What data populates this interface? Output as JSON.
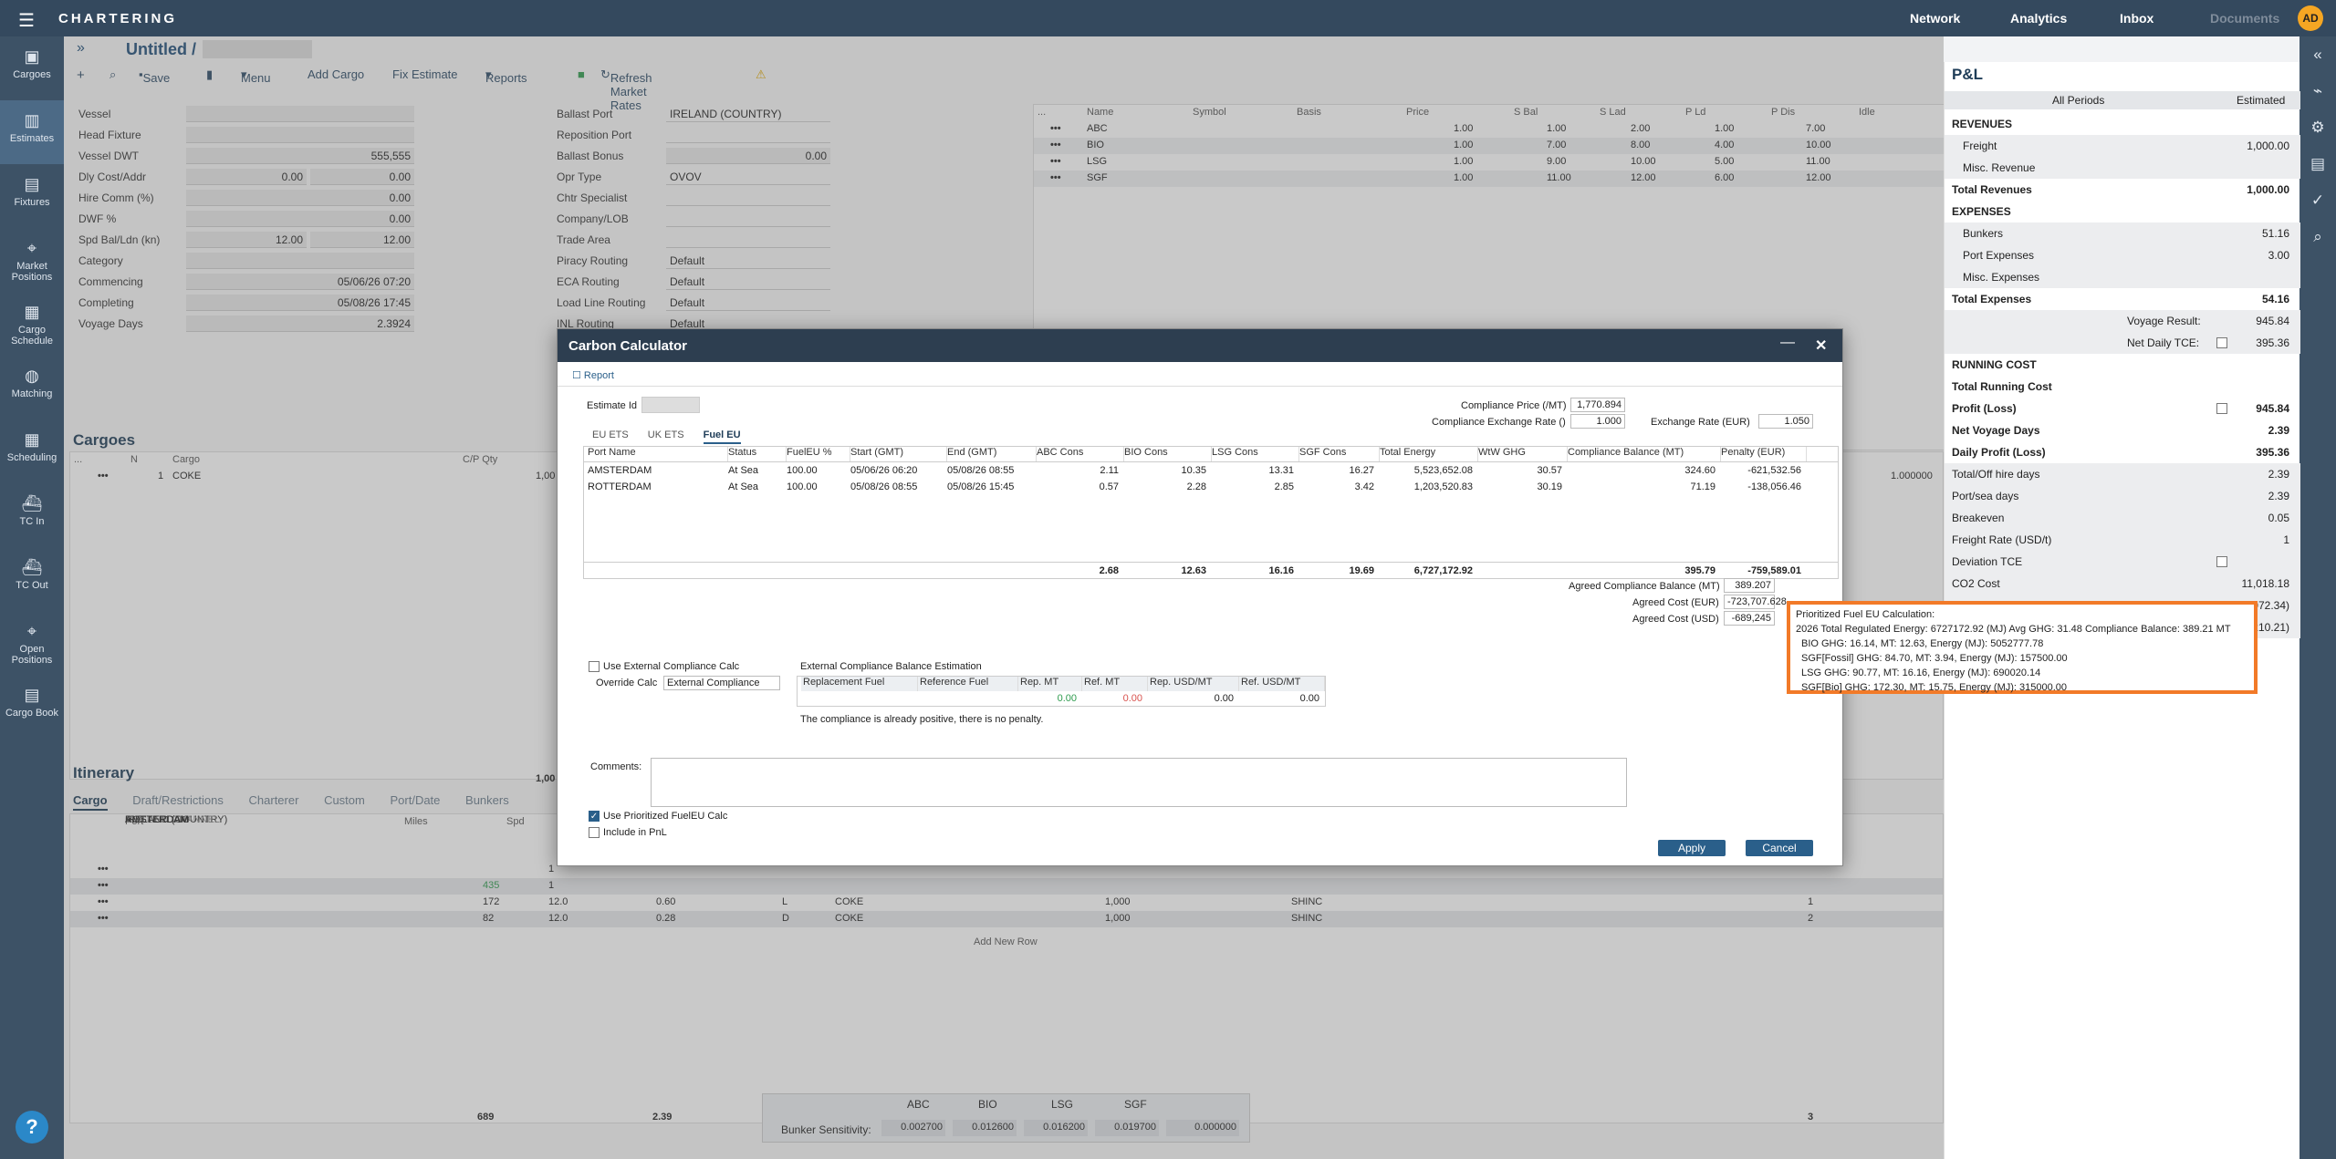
{
  "app": {
    "brand": "CHARTERING",
    "nav": [
      "Network",
      "Analytics",
      "Inbox",
      "Documents"
    ],
    "avatar": "AD"
  },
  "leftnav": [
    {
      "label": "Cargoes",
      "icon": "box-icon"
    },
    {
      "label": "Estimates",
      "icon": "columns-icon"
    },
    {
      "label": "Fixtures",
      "icon": "book-icon"
    },
    {
      "label": "Market Positions",
      "icon": "pin-icon"
    },
    {
      "label": "Cargo Schedule",
      "icon": "schedule-icon"
    },
    {
      "label": "Matching",
      "icon": "globe-icon"
    },
    {
      "label": "Scheduling",
      "icon": "calendar-icon"
    },
    {
      "label": "TC In",
      "icon": "ship-icon"
    },
    {
      "label": "TC Out",
      "icon": "ship-icon"
    },
    {
      "label": "Open Positions",
      "icon": "pin-icon"
    },
    {
      "label": "Cargo Book",
      "icon": "book-icon"
    }
  ],
  "header": {
    "title": "Untitled /",
    "toolbar": [
      "Save",
      "Menu",
      "Add Cargo",
      "Fix Estimate",
      "Reports",
      "Refresh Market Rates"
    ]
  },
  "form_left": [
    {
      "label": "Vessel",
      "v1": "",
      "v2": ""
    },
    {
      "label": "Head Fixture",
      "v1": "",
      "v2": ""
    },
    {
      "label": "Vessel DWT",
      "v1": "555,555",
      "v2": ""
    },
    {
      "label": "Dly Cost/Addr",
      "v1": "0.00",
      "v2": "0.00"
    },
    {
      "label": "Hire Comm (%)",
      "v1": "0.00",
      "v2": ""
    },
    {
      "label": "DWF %",
      "v1": "0.00",
      "v2": ""
    },
    {
      "label": "Spd Bal/Ldn (kn)",
      "v1": "12.00",
      "v2": "12.00"
    },
    {
      "label": "Category",
      "v1": "",
      "v2": ""
    },
    {
      "label": "Commencing",
      "v1": "05/06/26 07:20",
      "v2": ""
    },
    {
      "label": "Completing",
      "v1": "05/08/26 17:45",
      "v2": ""
    },
    {
      "label": "Voyage Days",
      "v1": "2.3924",
      "v2": ""
    }
  ],
  "form_mid": [
    {
      "label": "Ballast Port",
      "v": "IRELAND (COUNTRY)"
    },
    {
      "label": "Reposition Port",
      "v": ""
    },
    {
      "label": "Ballast Bonus",
      "v": "0.00"
    },
    {
      "label": "Opr Type",
      "v": "OVOV"
    },
    {
      "label": "Chtr Specialist",
      "v": ""
    },
    {
      "label": "Company/LOB",
      "v": ""
    },
    {
      "label": "Trade Area",
      "v": ""
    },
    {
      "label": "Piracy Routing",
      "v": "Default"
    },
    {
      "label": "ECA Routing",
      "v": "Default"
    },
    {
      "label": "Load Line Routing",
      "v": "Default"
    },
    {
      "label": "INL Routing",
      "v": "Default"
    }
  ],
  "fuel_grid": {
    "headers": [
      "...",
      "Name",
      "Symbol",
      "Basis",
      "Price",
      "S Bal",
      "S Lad",
      "P Ld",
      "P Dis",
      "Idle"
    ],
    "rows": [
      [
        "ABC",
        "1.00",
        "1.00",
        "2.00",
        "1.00",
        "7.00"
      ],
      [
        "BIO",
        "1.00",
        "7.00",
        "8.00",
        "4.00",
        "10.00"
      ],
      [
        "LSG",
        "1.00",
        "9.00",
        "10.00",
        "5.00",
        "11.00"
      ],
      [
        "SGF",
        "1.00",
        "11.00",
        "12.00",
        "6.00",
        "12.00"
      ]
    ]
  },
  "cargoes": {
    "title": "Cargoes",
    "headers": [
      "N",
      "Cargo",
      "C/P Qty"
    ],
    "row": [
      "1",
      "COKE",
      "1,00"
    ],
    "right_val": "1.000000",
    "total": "1,00"
  },
  "itinerary": {
    "title": "Itinerary",
    "tabs": [
      "Cargo",
      "Draft/Restrictions",
      "Charterer",
      "Custom",
      "Port/Date",
      "Bunkers"
    ],
    "headers": [
      "Port",
      "Miles",
      "Spd"
    ],
    "rows": [
      {
        "port": "IRELAND (COUNTRY)",
        "miles": "",
        "spd": "1",
        "a": "",
        "f": "",
        "cargo": "",
        "qty": "",
        "term": "",
        "n": ""
      },
      {
        "port": "ENGLISH CHANNEL",
        "miles": "435",
        "spd": "1",
        "a": "",
        "f": "",
        "cargo": "",
        "qty": "",
        "term": "",
        "n": ""
      },
      {
        "port": "AMSTERDAM",
        "miles": "172",
        "spd": "12.0",
        "a": "0.60",
        "f": "L",
        "cargo": "COKE",
        "qty": "1,000",
        "term": "SHINC",
        "n": "1"
      },
      {
        "port": "ROTTERDAM",
        "miles": "82",
        "spd": "12.0",
        "a": "0.28",
        "f": "D",
        "cargo": "COKE",
        "qty": "1,000",
        "term": "SHINC",
        "n": "2"
      }
    ],
    "add_row": "Add New Row",
    "totals": {
      "miles": "689",
      "days": "2.39",
      "n": "3"
    }
  },
  "bunker_sensitivity": {
    "label": "Bunker Sensitivity:",
    "names": [
      "ABC",
      "BIO",
      "LSG",
      "SGF"
    ],
    "values": [
      "0.002700",
      "0.012600",
      "0.016200",
      "0.019700",
      "0.000000"
    ]
  },
  "pnl": {
    "title": "P&L",
    "col_all": "All Periods",
    "col_est": "Estimated",
    "rows": [
      {
        "l": "REVENUES",
        "v": "",
        "type": "section"
      },
      {
        "l": "Freight",
        "v": "1,000.00",
        "type": "sub"
      },
      {
        "l": "Misc. Revenue",
        "v": "",
        "type": "sub"
      },
      {
        "l": "Total Revenues",
        "v": "1,000.00",
        "type": "total"
      },
      {
        "l": "EXPENSES",
        "v": "",
        "type": "section"
      },
      {
        "l": "Bunkers",
        "v": "51.16",
        "type": "sub"
      },
      {
        "l": "Port Expenses",
        "v": "3.00",
        "type": "sub"
      },
      {
        "l": "Misc. Expenses",
        "v": "",
        "type": "sub"
      },
      {
        "l": "Total Expenses",
        "v": "54.16",
        "type": "total"
      },
      {
        "l": "Voyage Result:",
        "v": "945.84",
        "type": "result"
      },
      {
        "l": "Net Daily TCE:",
        "v": "395.36",
        "type": "result"
      },
      {
        "l": "RUNNING COST",
        "v": "",
        "type": "section"
      },
      {
        "l": "Total Running Cost",
        "v": "",
        "type": "total"
      },
      {
        "l": "Profit (Loss)",
        "v": "945.84",
        "type": "total"
      },
      {
        "l": "Net Voyage Days",
        "v": "2.39",
        "type": "total"
      },
      {
        "l": "Daily Profit (Loss)",
        "v": "395.36",
        "type": "total"
      },
      {
        "l": "Total/Off hire days",
        "v": "2.39",
        "type": "plain"
      },
      {
        "l": "Port/sea days",
        "v": "2.39",
        "type": "plain"
      },
      {
        "l": "Breakeven",
        "v": "0.05",
        "type": "plain"
      },
      {
        "l": "Freight Rate (USD/t)",
        "v": "1",
        "type": "plain"
      },
      {
        "l": "Deviation TCE",
        "v": "",
        "type": "plain"
      },
      {
        "l": "CO2 Cost",
        "v": "11,018.18",
        "type": "plain"
      },
      {
        "l": "",
        "v": "072.34)",
        "type": "plain"
      },
      {
        "l": "",
        "v": "210.21)",
        "type": "plain"
      }
    ]
  },
  "modal": {
    "title": "Carbon Calculator",
    "report": "Report",
    "estimate_id_label": "Estimate Id",
    "compliance_price_label": "Compliance Price (/MT)",
    "compliance_price": "1,770.894",
    "compliance_rate_label": "Compliance Exchange Rate ()",
    "compliance_rate": "1.000",
    "exchange_rate_label": "Exchange Rate (EUR)",
    "exchange_rate": "1.050",
    "tabs": [
      "EU ETS",
      "UK ETS",
      "Fuel EU"
    ],
    "headers": [
      "Port Name",
      "Status",
      "FuelEU %",
      "Start (GMT)",
      "End (GMT)",
      "ABC Cons",
      "BIO Cons",
      "LSG Cons",
      "SGF Cons",
      "Total Energy",
      "WtW GHG",
      "Compliance Balance (MT)",
      "Penalty (EUR)"
    ],
    "rows": [
      [
        "AMSTERDAM",
        "At Sea",
        "100.00",
        "05/06/26 06:20",
        "05/08/26 08:55",
        "2.11",
        "10.35",
        "13.31",
        "16.27",
        "5,523,652.08",
        "30.57",
        "324.60",
        "-621,532.56"
      ],
      [
        "ROTTERDAM",
        "At Sea",
        "100.00",
        "05/08/26 08:55",
        "05/08/26 15:45",
        "0.57",
        "2.28",
        "2.85",
        "3.42",
        "1,203,520.83",
        "30.19",
        "71.19",
        "-138,056.46"
      ]
    ],
    "totals": [
      "2.68",
      "12.63",
      "16.16",
      "19.69",
      "6,727,172.92",
      "",
      "395.79",
      "-759,589.01"
    ],
    "agreed_balance_label": "Agreed Compliance Balance (MT)",
    "agreed_balance": "389.207",
    "agreed_eur_label": "Agreed Cost (EUR)",
    "agreed_eur": "-723,707.628",
    "agreed_usd_label": "Agreed Cost (USD)",
    "agreed_usd": "-689,245",
    "use_external": "Use External Compliance Calc",
    "override_label": "Override Calc",
    "override_val": "External Compliance",
    "ext_title": "External Compliance Balance Estimation",
    "ext_headers": [
      "Replacement Fuel",
      "Reference Fuel",
      "Rep. MT",
      "Ref. MT",
      "Rep. USD/MT",
      "Ref. USD/MT"
    ],
    "ext_values": [
      "",
      "",
      "0.00",
      "0.00",
      "0.00",
      "0.00"
    ],
    "positive_msg": "The compliance is already positive, there is no penalty.",
    "comments_label": "Comments:",
    "use_prioritized": "Use Prioritized FuelEU Calc",
    "include_pnl": "Include in PnL",
    "apply": "Apply",
    "cancel": "Cancel"
  },
  "tooltip": {
    "lines": [
      "Prioritized Fuel EU Calculation:",
      "2026 Total Regulated Energy: 6727172.92 (MJ) Avg GHG: 31.48 Compliance Balance: 389.21 MT",
      "BIO GHG: 16.14, MT: 12.63, Energy (MJ): 5052777.78",
      "SGF[Fossil] GHG: 84.70, MT: 3.94, Energy (MJ): 157500.00",
      "LSG GHG: 90.77, MT: 16.16, Energy (MJ): 690020.14",
      "SGF[Bio] GHG: 172.30, MT: 15.75, Energy (MJ): 315000.00"
    ]
  },
  "colors": {
    "topbar": "#34495e",
    "accent": "#2a5f8a",
    "tooltip_border": "#f27a28"
  }
}
